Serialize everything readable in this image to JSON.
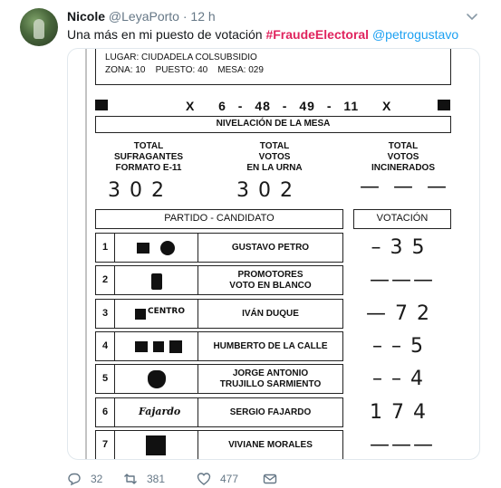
{
  "tweet": {
    "author_name": "Nicole",
    "handle": "@LeyaPorto",
    "separator": "·",
    "time": "12 h",
    "text_prefix": "Una más en mi puesto de votación ",
    "hashtag": "#FraudeElectoral",
    "mention": "@petrogustavo",
    "replies": "32",
    "retweets": "381",
    "likes": "477"
  },
  "form": {
    "lugar": "LUGAR: CIUDADELA COLSUBSIDIO",
    "zona_line": "ZONA: 10    PUESTO: 40    MESA: 029",
    "code": "X  6 - 48 - 49 - 11  X",
    "nivelacion": "NIVELACIÓN DE LA MESA",
    "col1_title": "TOTAL\nSUFRAGANTES\nFORMATO E-11",
    "col2_title": "TOTAL\nVOTOS\nEN LA URNA",
    "col3_title": "TOTAL\nVOTOS\nINCINERADOS",
    "col1_value": "302",
    "col2_value": "302",
    "col3_value": "— — —",
    "partido_header": "PARTIDO - CANDIDATO",
    "votacion_header": "VOTACIÓN",
    "rows": [
      {
        "num": "1",
        "candidate": "GUSTAVO PETRO",
        "vote": "–35"
      },
      {
        "num": "2",
        "candidate": "PROMOTORES\nVOTO EN BLANCO",
        "vote": "———"
      },
      {
        "num": "3",
        "candidate": "IVÁN DUQUE",
        "vote": "—72"
      },
      {
        "num": "4",
        "candidate": "HUMBERTO DE LA CALLE",
        "vote": "––5"
      },
      {
        "num": "5",
        "candidate": "JORGE ANTONIO\nTRUJILLO SARMIENTO",
        "vote": "––4"
      },
      {
        "num": "6",
        "candidate": "SERGIO FAJARDO",
        "vote": "174"
      },
      {
        "num": "7",
        "candidate": "VIVIANE MORALES",
        "vote": "———"
      }
    ],
    "logo_fajardo": "Fajardo",
    "logo_centro": "CENTRO"
  }
}
